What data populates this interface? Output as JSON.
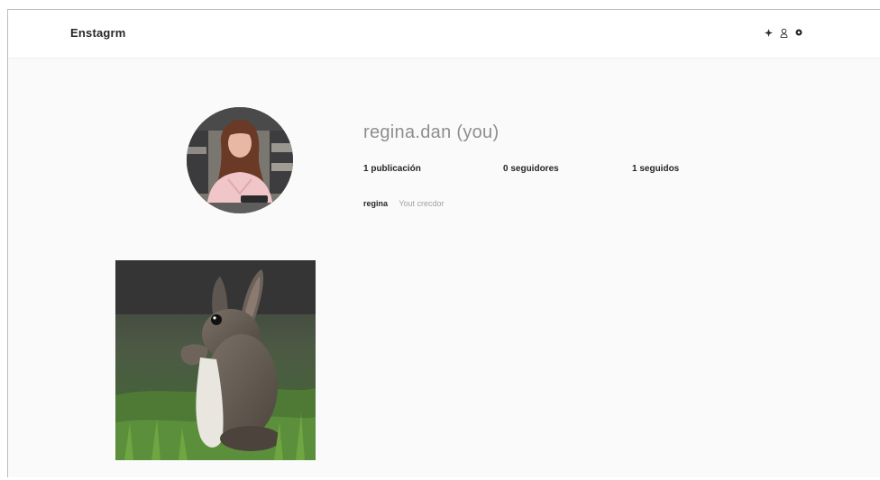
{
  "header": {
    "brand": "Enstagrm",
    "icons": [
      "compass-icon",
      "heart-icon",
      "profile-icon"
    ]
  },
  "profile": {
    "username": "regina.dan (you)",
    "stats": {
      "posts": "1 publicación",
      "followers": "0 seguidores",
      "following": "1 seguidos"
    },
    "bio_name": "regina",
    "bio_text": "Yout crecdor"
  },
  "posts": [
    {
      "subject": "rabbit-photo"
    }
  ],
  "colors": {
    "background": "#fafafa",
    "header": "#ffffff",
    "text": "#262626",
    "muted": "#8e8e8e"
  }
}
